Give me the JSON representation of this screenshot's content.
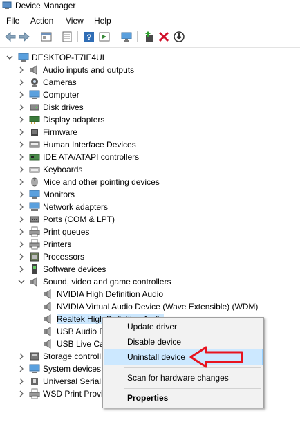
{
  "window": {
    "title": "Device Manager"
  },
  "menu": [
    "File",
    "Action",
    "View",
    "Help"
  ],
  "toolbar_icons": [
    "back-arrow-icon",
    "forward-arrow-icon",
    "properties-grid-icon",
    "device-list-icon",
    "help-icon",
    "show-hidden-icon",
    "monitor-scan-icon",
    "update-driver-icon",
    "uninstall-x-icon",
    "download-icon"
  ],
  "tree": {
    "root": "DESKTOP-T7IE4UL",
    "categories": [
      {
        "label": "Audio inputs and outputs",
        "icon": "speaker-icon"
      },
      {
        "label": "Cameras",
        "icon": "camera-icon"
      },
      {
        "label": "Computer",
        "icon": "monitor-icon"
      },
      {
        "label": "Disk drives",
        "icon": "disk-icon"
      },
      {
        "label": "Display adapters",
        "icon": "display-adapter-icon"
      },
      {
        "label": "Firmware",
        "icon": "chip-icon"
      },
      {
        "label": "Human Interface Devices",
        "icon": "hid-icon"
      },
      {
        "label": "IDE ATA/ATAPI controllers",
        "icon": "ide-icon"
      },
      {
        "label": "Keyboards",
        "icon": "keyboard-icon"
      },
      {
        "label": "Mice and other pointing devices",
        "icon": "mouse-icon"
      },
      {
        "label": "Monitors",
        "icon": "monitor-icon"
      },
      {
        "label": "Network adapters",
        "icon": "network-icon"
      },
      {
        "label": "Ports (COM & LPT)",
        "icon": "port-icon"
      },
      {
        "label": "Print queues",
        "icon": "printer-icon"
      },
      {
        "label": "Printers",
        "icon": "printer-icon"
      },
      {
        "label": "Processors",
        "icon": "processor-icon"
      },
      {
        "label": "Software devices",
        "icon": "software-device-icon"
      },
      {
        "label": "Sound, video and game controllers",
        "icon": "speaker-icon"
      }
    ],
    "sound_children": [
      "NVIDIA High Definition Audio",
      "NVIDIA Virtual Audio Device (Wave Extensible) (WDM)",
      "Realtek High Definition Audio",
      "USB Audio D",
      "USB Live Car"
    ],
    "after": [
      {
        "label": "Storage controll",
        "icon": "storage-icon"
      },
      {
        "label": "System devices",
        "icon": "system-device-icon"
      },
      {
        "label": "Universal Serial B",
        "icon": "usb-icon"
      },
      {
        "label": "WSD Print Provi",
        "icon": "printer-icon"
      }
    ]
  },
  "context_menu": {
    "update": "Update driver",
    "disable": "Disable device",
    "uninstall": "Uninstall device",
    "scan": "Scan for hardware changes",
    "properties": "Properties"
  },
  "colors": {
    "selection": "#cce8ff",
    "arrow": "#e8131f"
  }
}
